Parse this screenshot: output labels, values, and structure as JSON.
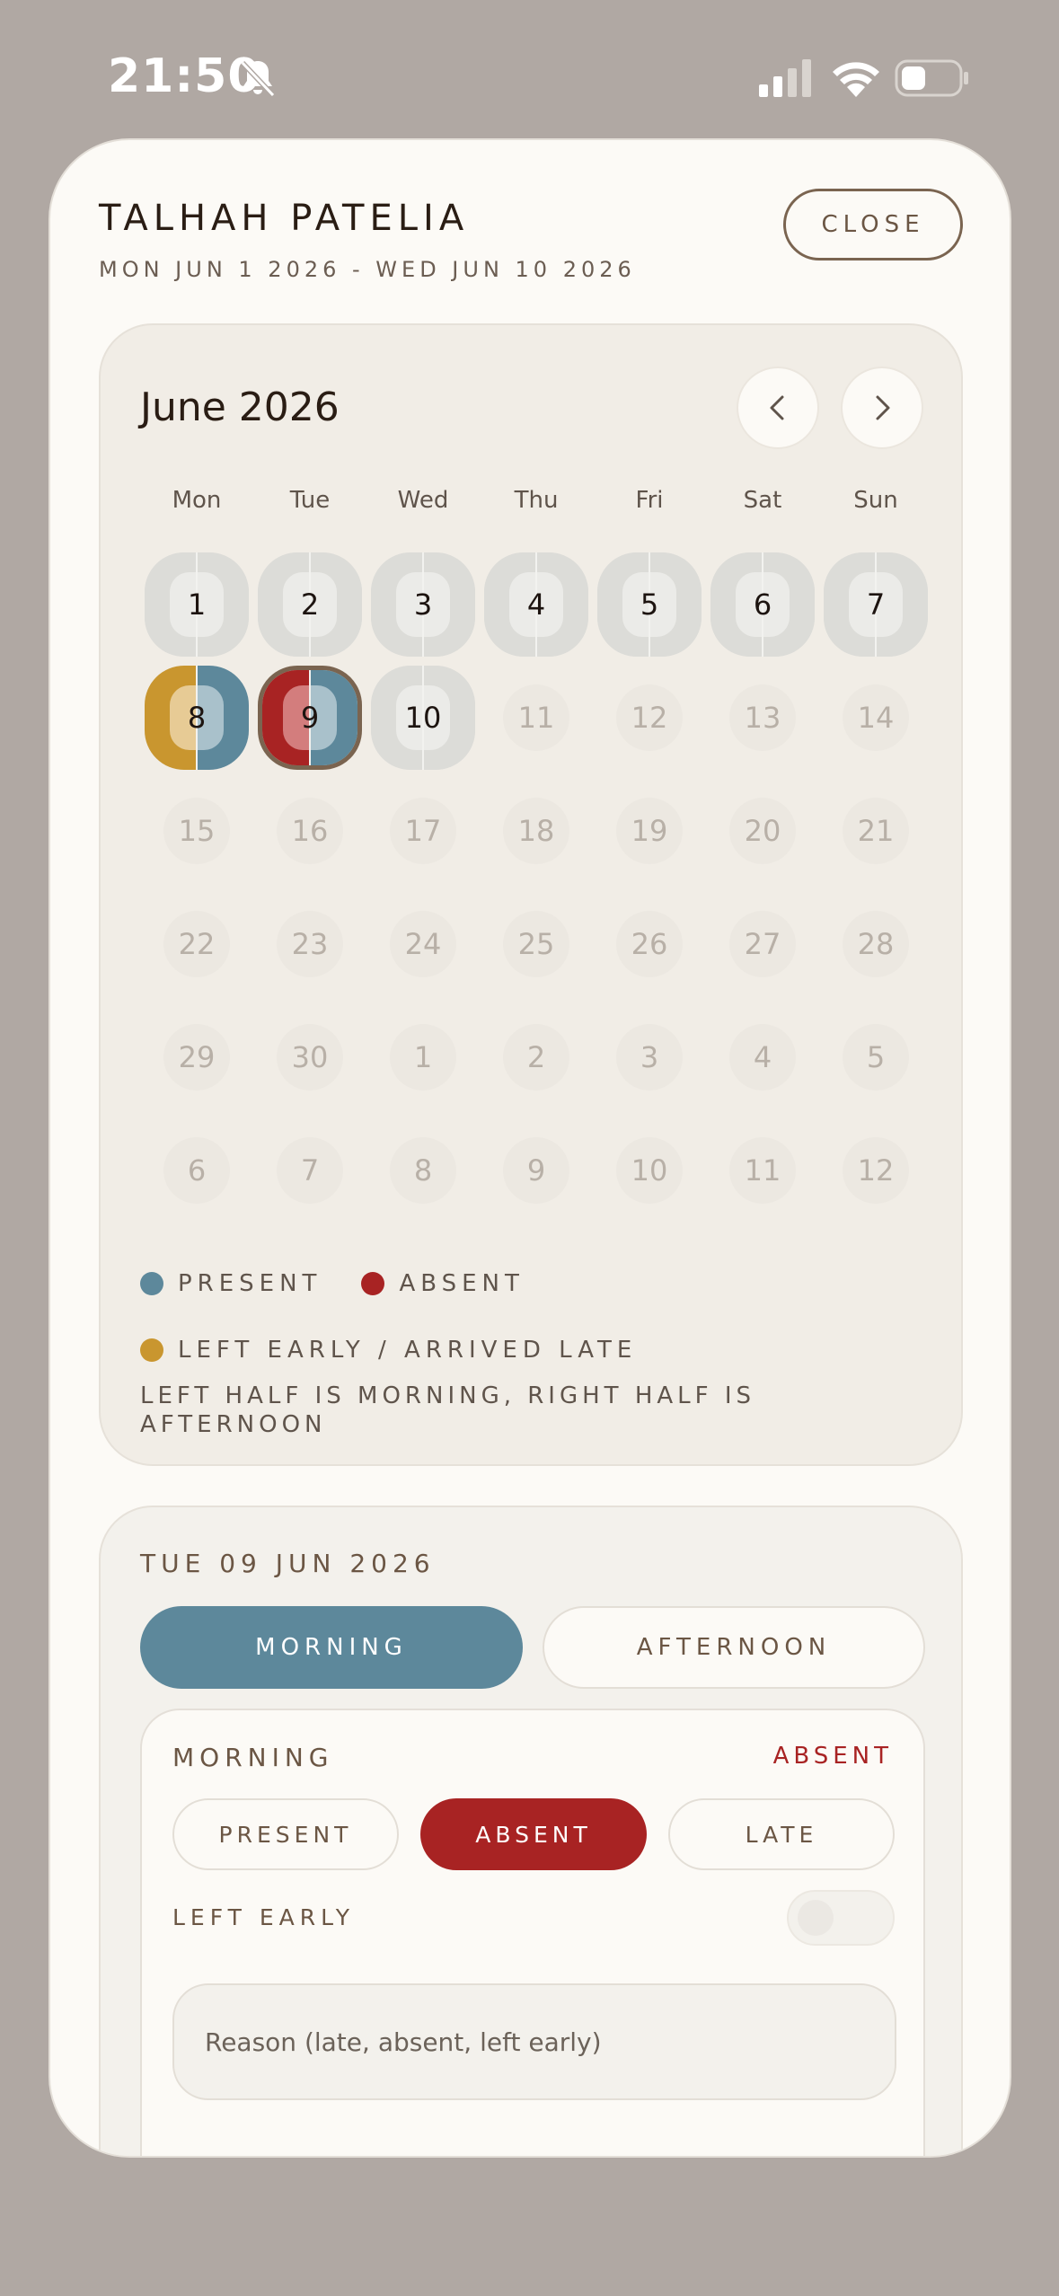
{
  "status_bar": {
    "time": "21:50",
    "icons": [
      "bell-slash-icon",
      "cellular-signal-icon",
      "wifi-icon",
      "battery-icon"
    ]
  },
  "header": {
    "student_name": "TALHAH PATELIA",
    "date_range": "MON JUN 1 2026 - WED JUN 10 2026",
    "close_label": "CLOSE"
  },
  "calendar": {
    "month_label": "June 2026",
    "prev_icon": "chevron-left-icon",
    "next_icon": "chevron-right-icon",
    "weekdays": [
      "Mon",
      "Tue",
      "Wed",
      "Thu",
      "Fri",
      "Sat",
      "Sun"
    ],
    "weeks": [
      [
        {
          "d": "1",
          "morning": "none",
          "afternoon": "none"
        },
        {
          "d": "2",
          "morning": "none",
          "afternoon": "none"
        },
        {
          "d": "3",
          "morning": "none",
          "afternoon": "none"
        },
        {
          "d": "4",
          "morning": "none",
          "afternoon": "none"
        },
        {
          "d": "5",
          "morning": "none",
          "afternoon": "none"
        },
        {
          "d": "6",
          "morning": "none",
          "afternoon": "none"
        },
        {
          "d": "7",
          "morning": "none",
          "afternoon": "none"
        }
      ],
      [
        {
          "d": "8",
          "morning": "late",
          "afternoon": "present"
        },
        {
          "d": "9",
          "morning": "absent",
          "afternoon": "present",
          "selected": true
        },
        {
          "d": "10",
          "morning": "none",
          "afternoon": "none"
        },
        {
          "d": "11",
          "faded": true
        },
        {
          "d": "12",
          "faded": true
        },
        {
          "d": "13",
          "faded": true
        },
        {
          "d": "14",
          "faded": true
        }
      ],
      [
        {
          "d": "15",
          "faded": true
        },
        {
          "d": "16",
          "faded": true
        },
        {
          "d": "17",
          "faded": true
        },
        {
          "d": "18",
          "faded": true
        },
        {
          "d": "19",
          "faded": true
        },
        {
          "d": "20",
          "faded": true
        },
        {
          "d": "21",
          "faded": true
        }
      ],
      [
        {
          "d": "22",
          "faded": true
        },
        {
          "d": "23",
          "faded": true
        },
        {
          "d": "24",
          "faded": true
        },
        {
          "d": "25",
          "faded": true
        },
        {
          "d": "26",
          "faded": true
        },
        {
          "d": "27",
          "faded": true
        },
        {
          "d": "28",
          "faded": true
        }
      ],
      [
        {
          "d": "29",
          "faded": true
        },
        {
          "d": "30",
          "faded": true
        },
        {
          "d": "1",
          "faded": true
        },
        {
          "d": "2",
          "faded": true
        },
        {
          "d": "3",
          "faded": true
        },
        {
          "d": "4",
          "faded": true
        },
        {
          "d": "5",
          "faded": true
        }
      ],
      [
        {
          "d": "6",
          "faded": true
        },
        {
          "d": "7",
          "faded": true
        },
        {
          "d": "8",
          "faded": true
        },
        {
          "d": "9",
          "faded": true
        },
        {
          "d": "10",
          "faded": true
        },
        {
          "d": "11",
          "faded": true
        },
        {
          "d": "12",
          "faded": true
        }
      ]
    ],
    "legend": {
      "present": "PRESENT",
      "absent": "ABSENT",
      "late": "LEFT EARLY / ARRIVED LATE",
      "note": "LEFT HALF IS MORNING, RIGHT HALF IS AFTERNOON"
    }
  },
  "colors": {
    "present": "#5d889b",
    "absent": "#a82323",
    "late": "#c9962f",
    "none": "#dcdcd8",
    "selected_border": "#7a6450"
  },
  "detail": {
    "date": "TUE 09 JUN 2026",
    "tabs": {
      "morning": "MORNING",
      "afternoon": "AFTERNOON"
    },
    "active_tab": "MORNING",
    "session": {
      "title": "MORNING",
      "status": "ABSENT",
      "options": {
        "present": "PRESENT",
        "absent": "ABSENT",
        "late": "LATE"
      },
      "selected_option": "ABSENT",
      "left_early_label": "LEFT EARLY",
      "left_early_on": false,
      "reason_placeholder": "Reason (late, absent, left early)"
    }
  }
}
